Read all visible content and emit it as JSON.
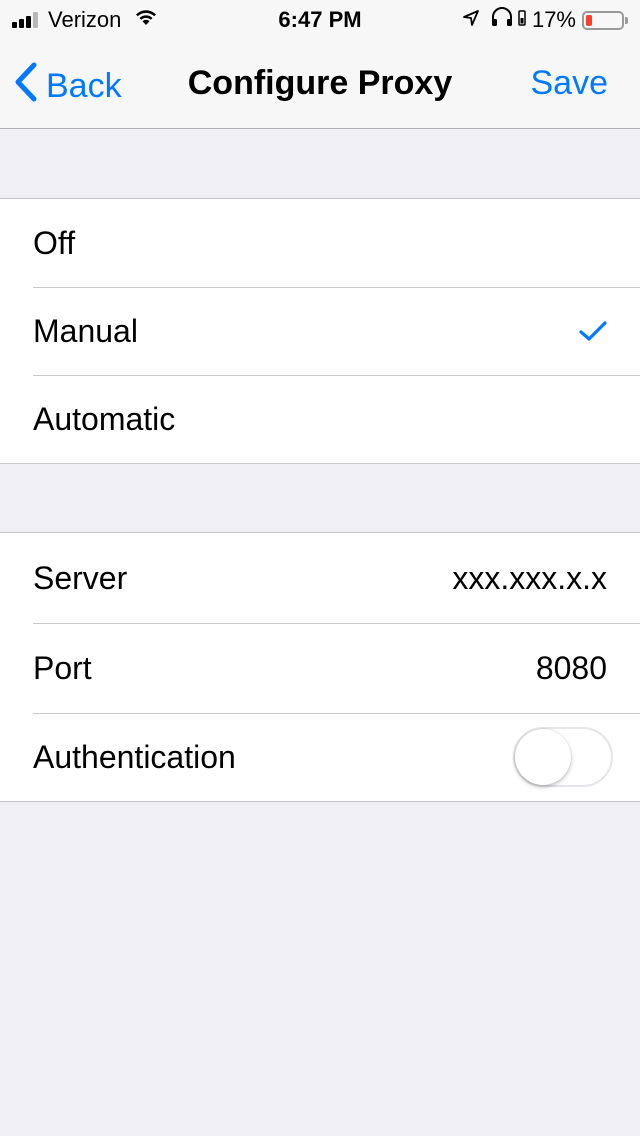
{
  "status_bar": {
    "carrier": "Verizon",
    "time": "6:47 PM",
    "battery_percent": "17%",
    "battery_level": 0.17,
    "icons": [
      "signal-bars-icon",
      "wifi-icon",
      "location-arrow-icon",
      "headphones-icon",
      "battery-icon"
    ],
    "battery_color": "#ff3b30"
  },
  "nav": {
    "back_label": "Back",
    "title": "Configure Proxy",
    "save_label": "Save"
  },
  "proxy_modes": {
    "options": [
      "Off",
      "Manual",
      "Automatic"
    ],
    "selected": "Manual"
  },
  "settings": {
    "server_label": "Server",
    "server_value": "xxx.xxx.x.x",
    "port_label": "Port",
    "port_value": "8080",
    "auth_label": "Authentication",
    "auth_enabled": false
  },
  "colors": {
    "accent": "#007aff",
    "background": "#efeff4"
  }
}
